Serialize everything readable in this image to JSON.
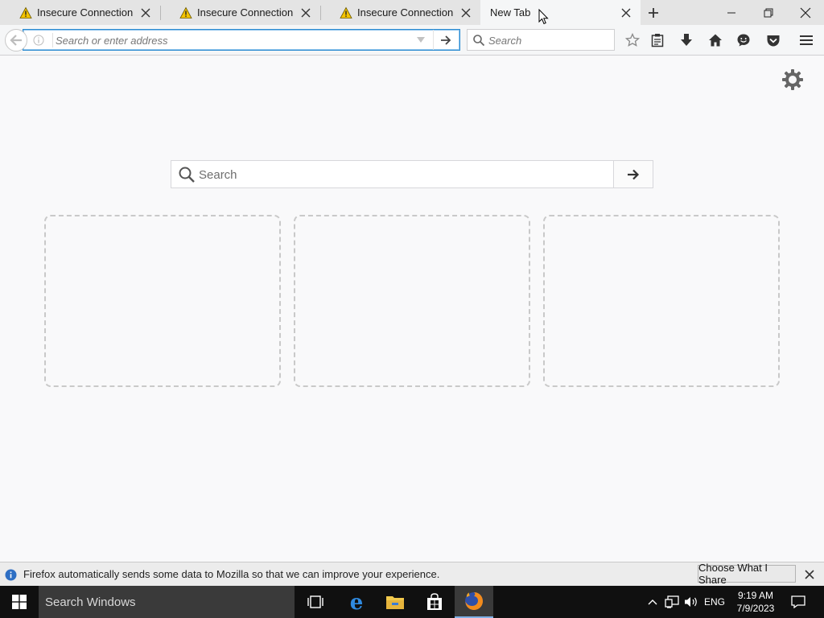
{
  "tabs": [
    {
      "title": "Insecure Connection",
      "warning": true,
      "active": false
    },
    {
      "title": "Insecure Connection",
      "warning": true,
      "active": false
    },
    {
      "title": "Insecure Connection",
      "warning": true,
      "active": false
    },
    {
      "title": "New Tab",
      "warning": false,
      "active": true
    }
  ],
  "navbar": {
    "url_placeholder": "Search or enter address",
    "search_placeholder": "Search"
  },
  "content": {
    "search_placeholder": "Search"
  },
  "notification": {
    "message": "Firefox automatically sends some data to Mozilla so that we can improve your experience.",
    "button_label": "Choose What I Share"
  },
  "taskbar": {
    "search_text": "Search Windows",
    "language": "ENG",
    "time": "9:19 AM",
    "date": "7/9/2023"
  },
  "colors": {
    "accent": "#2b8bd1",
    "taskbar": "#101010",
    "warning": "#f5c400"
  }
}
